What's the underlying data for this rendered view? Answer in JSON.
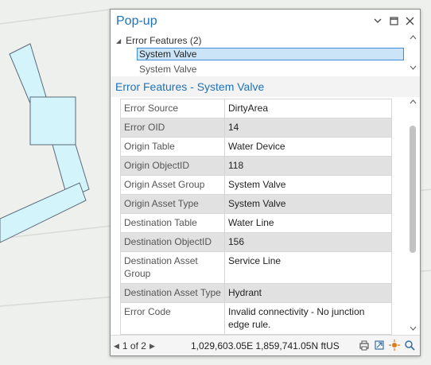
{
  "popup": {
    "title": "Pop-up",
    "controls": {
      "dropdown": "⌄",
      "maximize": "☐",
      "close": "✕"
    },
    "tree": {
      "group_label": "Error Features (2)",
      "selected_item": "System Valve",
      "next_item": "System Valve"
    },
    "subtitle": "Error Features - System Valve",
    "attributes": [
      {
        "key": "Error Source",
        "value": "DirtyArea"
      },
      {
        "key": "Error OID",
        "value": "14"
      },
      {
        "key": "Origin Table",
        "value": "Water Device"
      },
      {
        "key": "Origin ObjectID",
        "value": "118"
      },
      {
        "key": "Origin Asset Group",
        "value": "System Valve"
      },
      {
        "key": "Origin Asset Type",
        "value": "System Valve"
      },
      {
        "key": "Destination Table",
        "value": "Water Line"
      },
      {
        "key": "Destination ObjectID",
        "value": "156"
      },
      {
        "key": "Destination Asset Group",
        "value": "Service Line"
      },
      {
        "key": "Destination Asset Type",
        "value": "Hydrant"
      },
      {
        "key": "Error Code",
        "value": "Invalid connectivity - No junction edge rule."
      }
    ],
    "status": {
      "page": "1 of 2",
      "coordinates": "1,029,603.05E 1,859,741.05N ftUS"
    }
  },
  "colors": {
    "title": "#1f72b8",
    "selection_bg": "#cce4f7",
    "selection_border": "#3c8ed8",
    "map_bg": "#eef0ed",
    "feature_fill": "#d4f4fb",
    "feature_stroke": "#5a6a7a"
  },
  "icons": [
    "dropdown-icon",
    "maximize-icon",
    "close-icon",
    "collapse-triangle-icon",
    "prev-arrow-icon",
    "next-arrow-icon",
    "copy-icon",
    "export-icon",
    "flash-icon",
    "zoom-icon"
  ]
}
